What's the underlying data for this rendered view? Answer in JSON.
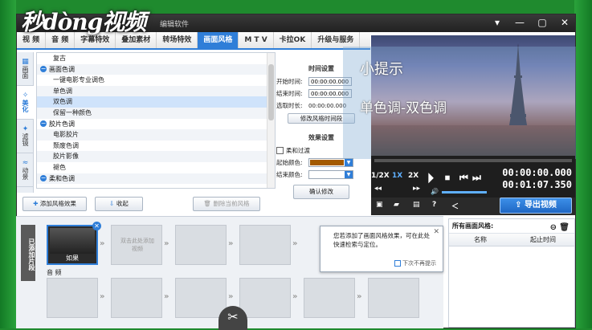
{
  "window": {
    "title": "编辑软件",
    "watermark": "秒dòng视频"
  },
  "tabs": [
    {
      "label": "视 频",
      "active": false
    },
    {
      "label": "音 频",
      "active": false
    },
    {
      "label": "字幕特效",
      "active": false
    },
    {
      "label": "叠加素材",
      "active": false
    },
    {
      "label": "转场特效",
      "active": false
    },
    {
      "label": "画面风格",
      "active": true
    },
    {
      "label": "M T V",
      "active": false
    },
    {
      "label": "卡拉OK",
      "active": false
    },
    {
      "label": "升级与服务",
      "active": false
    }
  ],
  "sidebar": {
    "items": [
      {
        "label": "画面",
        "icon": "grid-icon",
        "active": false
      },
      {
        "label": "美化",
        "icon": "magic-wand-icon",
        "active": true
      },
      {
        "label": "滤镜",
        "icon": "filter-icon",
        "active": false
      },
      {
        "label": "动景",
        "icon": "wave-icon",
        "active": false
      }
    ]
  },
  "style_list": {
    "rows": [
      {
        "label": "复古",
        "type": "item"
      },
      {
        "label": "画面色调",
        "type": "group"
      },
      {
        "label": "一键电影专业调色",
        "type": "item"
      },
      {
        "label": "单色调",
        "type": "item"
      },
      {
        "label": "双色调",
        "type": "item",
        "selected": true
      },
      {
        "label": "保留一种颜色",
        "type": "item"
      },
      {
        "label": "胶片色调",
        "type": "group"
      },
      {
        "label": "电影胶片",
        "type": "item"
      },
      {
        "label": "颓废色调",
        "type": "item"
      },
      {
        "label": "胶片影像",
        "type": "item"
      },
      {
        "label": "褪色",
        "type": "item"
      },
      {
        "label": "柔和色调",
        "type": "group"
      }
    ]
  },
  "actions": {
    "add_effect": "添加风格效果",
    "collapse": "收起",
    "delete_current": "删除当前风格"
  },
  "time_settings": {
    "title": "时间设置",
    "start_label": "开始时间:",
    "start_value": "00:00:00.000",
    "end_label": "结束时间:",
    "end_value": "00:00:00.000",
    "duration_label": "选取时长:",
    "duration_value": "00:00:00.000",
    "modify_button": "修改风格时间段"
  },
  "effect_settings": {
    "title": "效果设置",
    "soft_transition_label": "柔和过渡",
    "start_color_label": "起始颜色:",
    "start_color": "#a35a00",
    "end_color_label": "结束颜色:",
    "end_color": "#ffffff",
    "confirm_button": "确认修改"
  },
  "hint": {
    "title": "小提示",
    "body": "单色调-双色调"
  },
  "player": {
    "speed_options": [
      "1/2X",
      "1X",
      "2X"
    ],
    "current_time": "00:00:00.000",
    "total_time": "00:01:07.350",
    "export_button": "导出视频"
  },
  "timeline": {
    "side_label": "已添加片段",
    "clip_name": "如果",
    "drop_hint": "双击此处添加视频",
    "audio_label": "音 频"
  },
  "tooltip": {
    "text": "您若添加了画面风格效果，可在此处快速检索与定位。",
    "checkbox_label": "下次不再提示"
  },
  "applied_styles": {
    "title": "所有画面风格:",
    "col_name": "名称",
    "col_start": "起止时间"
  }
}
